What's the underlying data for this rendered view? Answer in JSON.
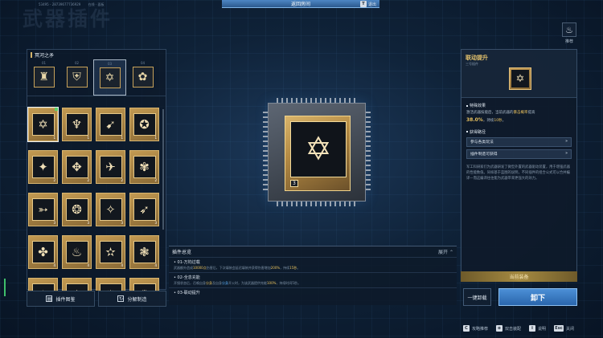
{
  "top_info": {
    "uid": "53495 - 28739677736929",
    "status": "在线  · 面板"
  },
  "page_title": "武器插件",
  "top_bar": {
    "label": "返回房间",
    "close_key": "T",
    "close_label": "退出"
  },
  "recommend": {
    "icon": "flame-icon",
    "label": "推荐"
  },
  "left_panel": {
    "weapon_name": "冥河之矛",
    "tabs": [
      {
        "num": "01",
        "icon": "castle-icon",
        "glyph": "♜"
      },
      {
        "num": "02",
        "icon": "shield-emblem-icon",
        "glyph": "⛨"
      },
      {
        "num": "03",
        "icon": "hexagram-icon",
        "glyph": "✡"
      },
      {
        "num": "04",
        "icon": "flower-gear-icon",
        "glyph": "✿"
      }
    ],
    "active_tab": 2
  },
  "plugins": [
    {
      "glyph": "✡",
      "lvl": "1",
      "selected": true
    },
    {
      "glyph": "♆",
      "lvl": "1"
    },
    {
      "glyph": "➹",
      "lvl": "1"
    },
    {
      "glyph": "✪",
      "lvl": "1"
    },
    {
      "glyph": "✦",
      "lvl": "2"
    },
    {
      "glyph": "✥",
      "lvl": "2"
    },
    {
      "glyph": "✈",
      "lvl": "2"
    },
    {
      "glyph": "✾",
      "lvl": "2"
    },
    {
      "glyph": "➳",
      "lvl": "3"
    },
    {
      "glyph": "❂",
      "lvl": "3"
    },
    {
      "glyph": "✧",
      "lvl": "3"
    },
    {
      "glyph": "➶",
      "lvl": "3"
    },
    {
      "glyph": "✤",
      "lvl": "4"
    },
    {
      "glyph": "♨",
      "lvl": "4"
    },
    {
      "glyph": "✫",
      "lvl": "4"
    },
    {
      "glyph": "❃",
      "lvl": "4"
    },
    {
      "glyph": "✶",
      "lvl": "5"
    },
    {
      "glyph": "✸",
      "lvl": "5"
    },
    {
      "glyph": "✹",
      "lvl": "5"
    },
    {
      "glyph": "✺",
      "lvl": "5"
    }
  ],
  "left_buttons": {
    "catalog": "插件图鉴",
    "dismantle": "分解制造"
  },
  "center_chip": {
    "icon": "hexagram-icon",
    "glyph": "✡",
    "tag": "3"
  },
  "summary": {
    "title": "插件总览",
    "expand": "展开",
    "items": [
      {
        "title": "01-万钧过载",
        "desc_a": "武器额外造成",
        "hl_a": "10000点",
        "desc_b": "伤害后，下次填装会延迟填装并获得伤害增加",
        "hl_b": "200%",
        "desc_c": "，持续",
        "hl_c": "15秒",
        "desc_d": "。"
      },
      {
        "title": "02-全息充能",
        "desc_a": "开镜状态后，召唤自身",
        "hl_a": "分身",
        "desc_b": "及自身",
        "hl_b": "分身",
        "desc_c": "开火时，为该武器提供充能",
        "hl_c": "100%",
        "desc_d": "，持续时间5秒。"
      },
      {
        "title": "03-联动提升",
        "desc_a": "",
        "hl_a": "",
        "desc_b": "",
        "hl_b": "",
        "desc_c": "",
        "hl_c": "",
        "desc_d": ""
      }
    ]
  },
  "right_panel": {
    "title": "联动提升",
    "subtitle": "三号插件",
    "icon": "hexagram-icon",
    "glyph": "✡",
    "effect_title": "特殊效果",
    "effect_a": "激活武器技能后，当前武器的",
    "effect_hl": "暴击概率",
    "effect_b": "提高",
    "effect_val": "38.0%",
    "effect_c": "，持续",
    "effect_dur": "10秒",
    "effect_d": "。",
    "source_title": "获得路径",
    "sources": [
      {
        "label": "参与各类玩法",
        "arrow": "»"
      },
      {
        "label": "插件制造可获得",
        "arrow": "»"
      }
    ],
    "story": "军工科研家们为武器研发了微型外置的武器驱动装置，用于增强武器的性能数值。同样基于蓝图的说明，不同插件的组合公式可以合并编译—而这编译往往能为武器带来更强大的效力。",
    "equipped_label": "当前装备"
  },
  "actions": {
    "unequip": "一键卸载",
    "unload": "卸下"
  },
  "bottom_hints": [
    {
      "key": "C",
      "label": "攻略推荐"
    },
    {
      "key": "⊕",
      "label": "双击装配"
    },
    {
      "key": "i",
      "label": "说明"
    },
    {
      "key": "Esc",
      "label": "关闭"
    }
  ]
}
